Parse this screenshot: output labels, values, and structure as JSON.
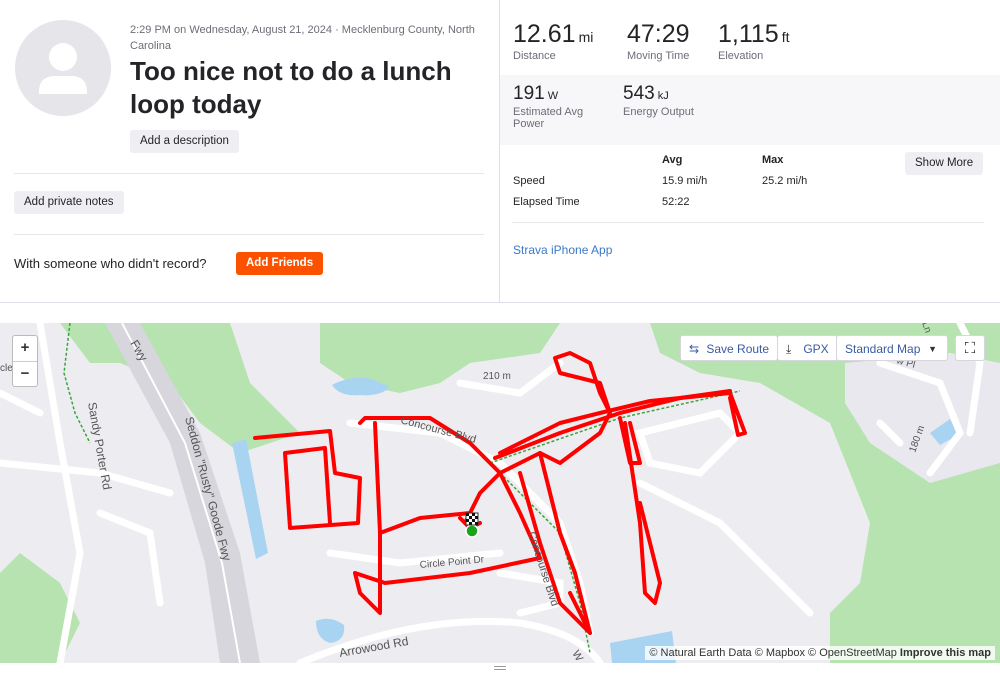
{
  "activity": {
    "meta": "2:29 PM on Wednesday, August 21, 2024 · Mecklenburg County, North Carolina",
    "title": "Too nice not to do a lunch loop today",
    "add_description": "Add a description",
    "add_private_notes": "Add private notes",
    "with_someone": "With someone who didn't record?",
    "add_friends": "Add Friends"
  },
  "stats": {
    "distance": {
      "value": "12.61",
      "unit": "mi",
      "label": "Distance"
    },
    "moving_time": {
      "value": "47:29",
      "label": "Moving Time"
    },
    "elevation": {
      "value": "1,115",
      "unit": "ft",
      "label": "Elevation"
    },
    "power": {
      "value": "191",
      "unit": "W",
      "label": "Estimated Avg Power"
    },
    "energy": {
      "value": "543",
      "unit": "kJ",
      "label": "Energy Output"
    }
  },
  "table": {
    "col_avg": "Avg",
    "col_max": "Max",
    "rows": [
      {
        "label": "Speed",
        "avg": "15.9 mi/h",
        "max": "25.2 mi/h"
      },
      {
        "label": "Elapsed Time",
        "avg": "52:22",
        "max": ""
      }
    ],
    "show_more": "Show More"
  },
  "device": "Strava iPhone App",
  "map": {
    "zoom_in": "+",
    "zoom_out": "−",
    "save_route": "Save Route",
    "gpx": "GPX",
    "style": "Standard Map",
    "attribution": "© Natural Earth Data © Mapbox © OpenStreetMap",
    "improve": "Improve this map",
    "labels": {
      "fwy_top": "Fwy",
      "sandy_porter": "Sandy Porter Rd",
      "seddon": "Seddon \"Rusty\" Goode Fwy",
      "concourse1": "Concourse Blvd",
      "concourse2": "Concourse Blvd",
      "elev210": "210 m",
      "elev180": "180 m",
      "arrowood": "Arrowood Rd",
      "circle": "Circle Point Dr",
      "w": "W",
      "ln": "Ln",
      "pl": "w Pl",
      "cle": "cle"
    },
    "colors": {
      "route": "#ff0000",
      "park": "#b6e3b0",
      "water": "#a8d4f2",
      "road": "#ffffff"
    }
  }
}
